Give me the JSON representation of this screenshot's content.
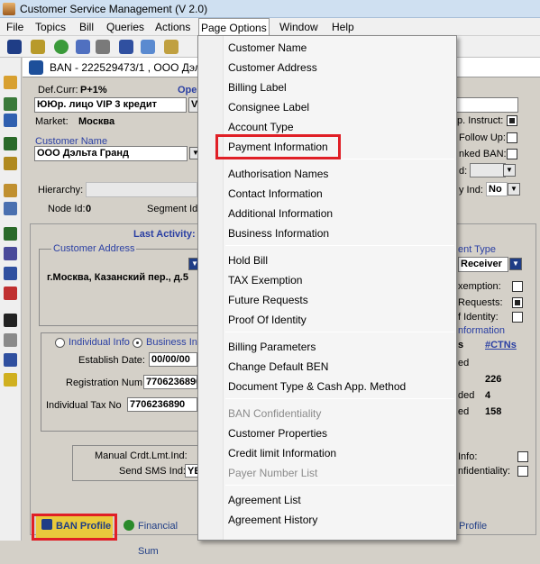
{
  "titlebar": {
    "title": "Customer Service Management  (V 2.0)"
  },
  "menubar": {
    "items": [
      "File",
      "Topics",
      "Bill",
      "Queries",
      "Actions",
      "Page Options",
      "Window",
      "Help"
    ]
  },
  "window": {
    "title": "BAN - 222529473/1 , ООО Дэльт"
  },
  "form": {
    "def_curr_label": "Def.Curr:",
    "def_curr_value": "P+1%",
    "ope_label": "Ope",
    "type_value": "ЮЮр. лицо VIP 3   кредит",
    "type_suffix": "V",
    "market_label": "Market:",
    "market_value": "Москва",
    "customer_name_label": "Customer Name",
    "customer_name_value": "ООО Дэльта Гранд",
    "hierarchy_label": "Hierarchy:",
    "node_id_label": "Node Id:",
    "node_id_value": "0",
    "segment_id_label": "Segment Id:",
    "p_instruct_label": "p. Instruct:",
    "follow_up_label": "Follow Up:",
    "linked_ban_label": "nked BAN:",
    "d_label": "d:",
    "y_ind_label": "y Ind:",
    "y_ind_value": "No"
  },
  "address": {
    "last_activity_label": "Last Activity:",
    "customer_address_label": "Customer Address",
    "address_value": "г.Москва, Казанский пер., д.5",
    "payment_type_label": "ent Type",
    "payment_type_value": "Receiver",
    "exemption_label": "xemption:",
    "requests_label": "Requests:",
    "identity_label": "f Identity:",
    "information_label": "nformation"
  },
  "details": {
    "individual_info": "Individual Info",
    "business_info": "Business In",
    "establish_date_label": "Establish Date:",
    "establish_date_value": "00/00/00",
    "registration_label": "Registration Num",
    "registration_value": "7706236890",
    "tax_label": "Individual Tax No",
    "tax_value": "7706236890",
    "ctns_header_left": "s",
    "ctns_header": "#CTNs",
    "row1_label": "ed",
    "row2_label": "",
    "row2_value": "226",
    "row3_label": "ded",
    "row3_value": "4",
    "row4_label": "ed",
    "row4_value": "158",
    "manual_crdt_label": "Manual Crdt.Lmt.Ind:",
    "send_sms_label": "Send SMS Ind:",
    "send_sms_value": "YE",
    "info_label": "Info:",
    "confidentiality_label": "nfidentiality:"
  },
  "tabs": {
    "ban_profile": "BAN Profile",
    "financial_summary": "Financial Sum",
    "profile": "Profile"
  },
  "dropdown": {
    "groups": [
      [
        "Customer Name",
        "Customer Address",
        "Billing Label",
        "Consignee Label",
        "Account Type",
        "Payment Information"
      ],
      [
        "Authorisation Names",
        "Contact Information",
        "Additional Information",
        "Business Information"
      ],
      [
        "Hold Bill",
        "TAX Exemption",
        "Future Requests",
        "Proof Of Identity"
      ],
      [
        "Billing Parameters",
        "Change Default BEN",
        "Document Type & Cash App. Method"
      ],
      [
        "BAN Confidentiality",
        "Customer Properties",
        "Credit limit Information",
        "Payer Number List"
      ],
      [
        "Agreement List",
        "Agreement History"
      ]
    ],
    "disabled": [
      "BAN Confidentiality",
      "Payer Number List"
    ],
    "highlighted": "Payment Information"
  },
  "colors": {
    "highlight_border": "#e01f26",
    "label_blue": "#2a3fa3"
  }
}
